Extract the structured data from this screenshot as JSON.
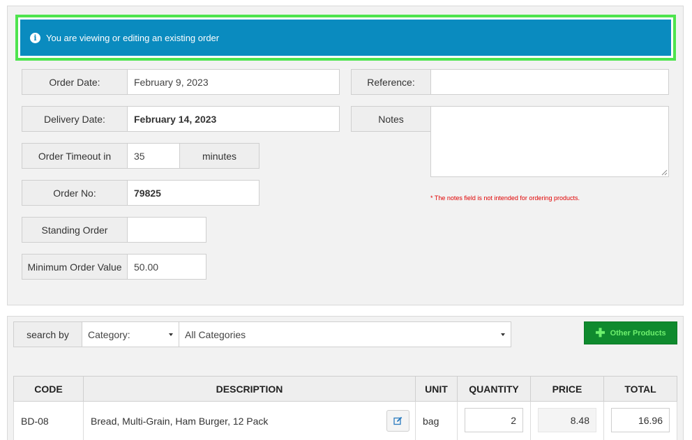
{
  "alert": {
    "icon": "info-icon",
    "text": "You are viewing or editing an existing order"
  },
  "order": {
    "order_date_label": "Order Date:",
    "order_date_value": "February 9, 2023",
    "delivery_date_label": "Delivery Date:",
    "delivery_date_value": "February 14, 2023",
    "timeout_label": "Order Timeout in",
    "timeout_value": "35",
    "timeout_unit": "minutes",
    "order_no_label": "Order No:",
    "order_no_value": "79825",
    "standing_order_label": "Standing Order",
    "standing_order_value": "",
    "min_order_label": "Minimum Order Value",
    "min_order_value": "50.00",
    "reference_label": "Reference:",
    "reference_value": "",
    "notes_label": "Notes",
    "notes_value": "",
    "notes_hint": "* The notes field is not intended for ordering products."
  },
  "search": {
    "label": "search by",
    "by_selected": "Category:",
    "category_selected": "All Categories",
    "other_products_label": "Other Products",
    "other_products_icon": "plus-icon"
  },
  "table": {
    "headers": [
      "CODE",
      "DESCRIPTION",
      "UNIT",
      "QUANTITY",
      "PRICE",
      "TOTAL"
    ],
    "rows": [
      {
        "code": "BD-08",
        "description": "Bread, Multi-Grain, Ham Burger, 12 Pack",
        "unit": "bag",
        "quantity": "2",
        "price": "8.48",
        "total": "16.96",
        "edit_icon": "edit-icon"
      }
    ]
  },
  "colors": {
    "alert_bg": "#0a8bbf",
    "highlight": "#4ee44e",
    "button_green": "#0f8a2e",
    "hint_red": "#e00000"
  }
}
